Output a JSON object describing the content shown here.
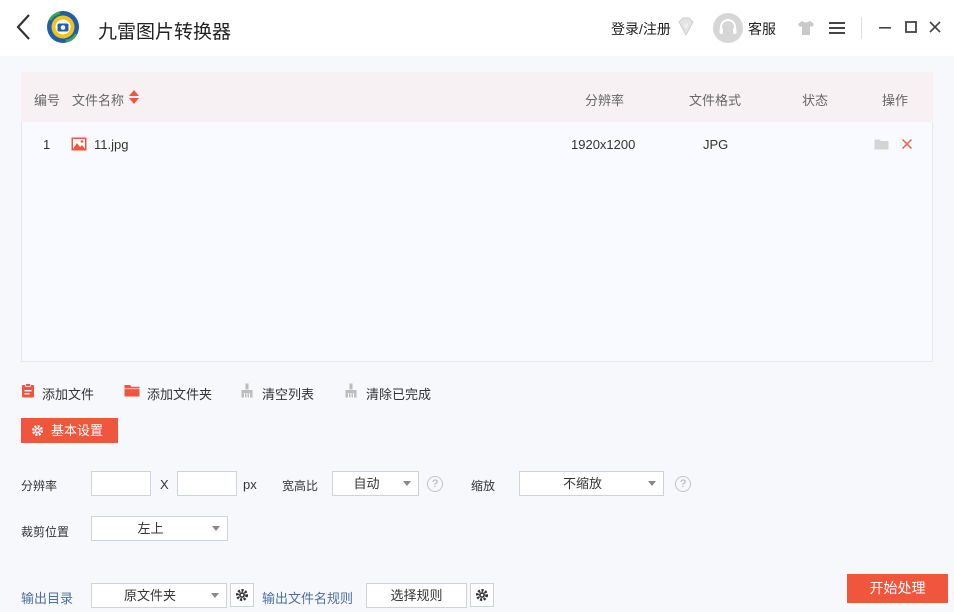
{
  "app": {
    "title": "九雷图片转换器"
  },
  "header": {
    "login_label": "登录/注册",
    "service_label": "客服"
  },
  "table": {
    "columns": [
      "编号",
      "文件名称",
      "分辨率",
      "文件格式",
      "状态",
      "操作"
    ],
    "rows": [
      {
        "index": "1",
        "name": "11.jpg",
        "resolution": "1920x1200",
        "format": "JPG",
        "status": ""
      }
    ]
  },
  "toolbar": {
    "add_file": "添加文件",
    "add_folder": "添加文件夹",
    "clear_list": "清空列表",
    "clear_done": "清除已完成"
  },
  "settings": {
    "basic_label": "基本设置",
    "resolution_label": "分辨率",
    "width_value": "",
    "height_value": "",
    "x_sep": "X",
    "unit": "px",
    "aspect_label": "宽高比",
    "aspect_value": "自动",
    "scale_label": "缩放",
    "scale_value": "不缩放",
    "crop_label": "裁剪位置",
    "crop_value": "左上",
    "output_dir_label": "输出目录",
    "output_dir_value": "原文件夹",
    "name_rule_label": "输出文件名规则",
    "name_rule_button": "选择规则",
    "help_glyph": "?"
  },
  "actions": {
    "start_label": "开始处理"
  },
  "colors": {
    "accent": "#f0563d",
    "header_bg": "#f8f1f4",
    "content_bg": "#f7f8fc",
    "link_blue": "#4a6fa5"
  }
}
